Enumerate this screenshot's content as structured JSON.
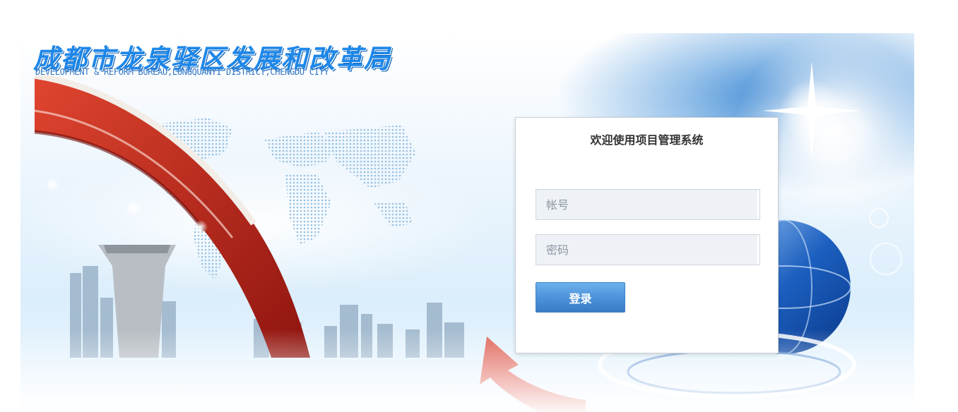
{
  "header": {
    "logo_cn": "成都市龙泉驿区发展和改革局",
    "logo_en": "DEVELOPMENT & REFORM BUREAU,LONGQUANYI DISTRICT,CHENGDU CITY"
  },
  "login": {
    "title": "欢迎使用项目管理系统",
    "username_placeholder": "帐号",
    "password_placeholder": "密码",
    "submit_label": "登录"
  },
  "colors": {
    "accent": "#4a90d9",
    "logo_blue": "#1e87e8",
    "bridge_red": "#c8261d"
  },
  "decorations": [
    "bridge-image",
    "world-map-image",
    "city-skyline-image",
    "globe-image",
    "red-arrow-image",
    "sparkle-icon"
  ]
}
